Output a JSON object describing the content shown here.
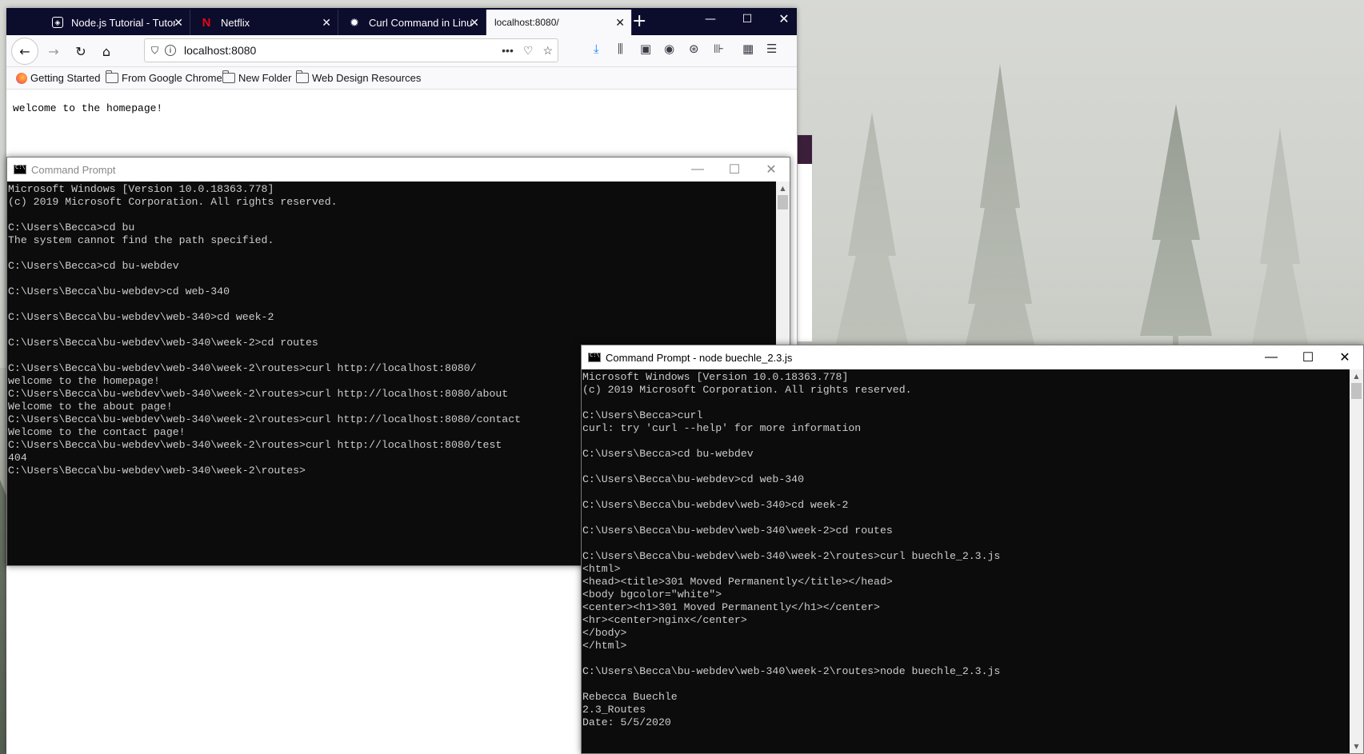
{
  "firefox": {
    "tabs": [
      {
        "title": "Node.js Tutorial - Tutor",
        "icon": "tutorial-icon"
      },
      {
        "title": "Netflix",
        "icon": "netflix-icon"
      },
      {
        "title": "Curl Command in Linu",
        "icon": "gear-icon"
      },
      {
        "title": "localhost:8080/",
        "icon": "",
        "active": true
      }
    ],
    "url": "localhost:8080",
    "bookmarks": [
      "Getting Started",
      "From Google Chrome",
      "New Folder",
      "Web Design Resources"
    ],
    "page_text": "welcome to the homepage!"
  },
  "cmd1": {
    "title": "Command Prompt",
    "lines": [
      "Microsoft Windows [Version 10.0.18363.778]",
      "(c) 2019 Microsoft Corporation. All rights reserved.",
      "",
      "C:\\Users\\Becca>cd bu",
      "The system cannot find the path specified.",
      "",
      "C:\\Users\\Becca>cd bu-webdev",
      "",
      "C:\\Users\\Becca\\bu-webdev>cd web-340",
      "",
      "C:\\Users\\Becca\\bu-webdev\\web-340>cd week-2",
      "",
      "C:\\Users\\Becca\\bu-webdev\\web-340\\week-2>cd routes",
      "",
      "C:\\Users\\Becca\\bu-webdev\\web-340\\week-2\\routes>curl http://localhost:8080/",
      "welcome to the homepage!",
      "C:\\Users\\Becca\\bu-webdev\\web-340\\week-2\\routes>curl http://localhost:8080/about",
      "Welcome to the about page!",
      "C:\\Users\\Becca\\bu-webdev\\web-340\\week-2\\routes>curl http://localhost:8080/contact",
      "Welcome to the contact page!",
      "C:\\Users\\Becca\\bu-webdev\\web-340\\week-2\\routes>curl http://localhost:8080/test",
      "404",
      "C:\\Users\\Becca\\bu-webdev\\web-340\\week-2\\routes>"
    ]
  },
  "cmd2": {
    "title": "Command Prompt - node  buechle_2.3.js",
    "lines": [
      "Microsoft Windows [Version 10.0.18363.778]",
      "(c) 2019 Microsoft Corporation. All rights reserved.",
      "",
      "C:\\Users\\Becca>curl",
      "curl: try 'curl --help' for more information",
      "",
      "C:\\Users\\Becca>cd bu-webdev",
      "",
      "C:\\Users\\Becca\\bu-webdev>cd web-340",
      "",
      "C:\\Users\\Becca\\bu-webdev\\web-340>cd week-2",
      "",
      "C:\\Users\\Becca\\bu-webdev\\web-340\\week-2>cd routes",
      "",
      "C:\\Users\\Becca\\bu-webdev\\web-340\\week-2\\routes>curl buechle_2.3.js",
      "<html>",
      "<head><title>301 Moved Permanently</title></head>",
      "<body bgcolor=\"white\">",
      "<center><h1>301 Moved Permanently</h1></center>",
      "<hr><center>nginx</center>",
      "</body>",
      "</html>",
      "",
      "C:\\Users\\Becca\\bu-webdev\\web-340\\week-2\\routes>node buechle_2.3.js",
      "",
      "Rebecca Buechle",
      "2.3_Routes",
      "Date: 5/5/2020"
    ]
  }
}
